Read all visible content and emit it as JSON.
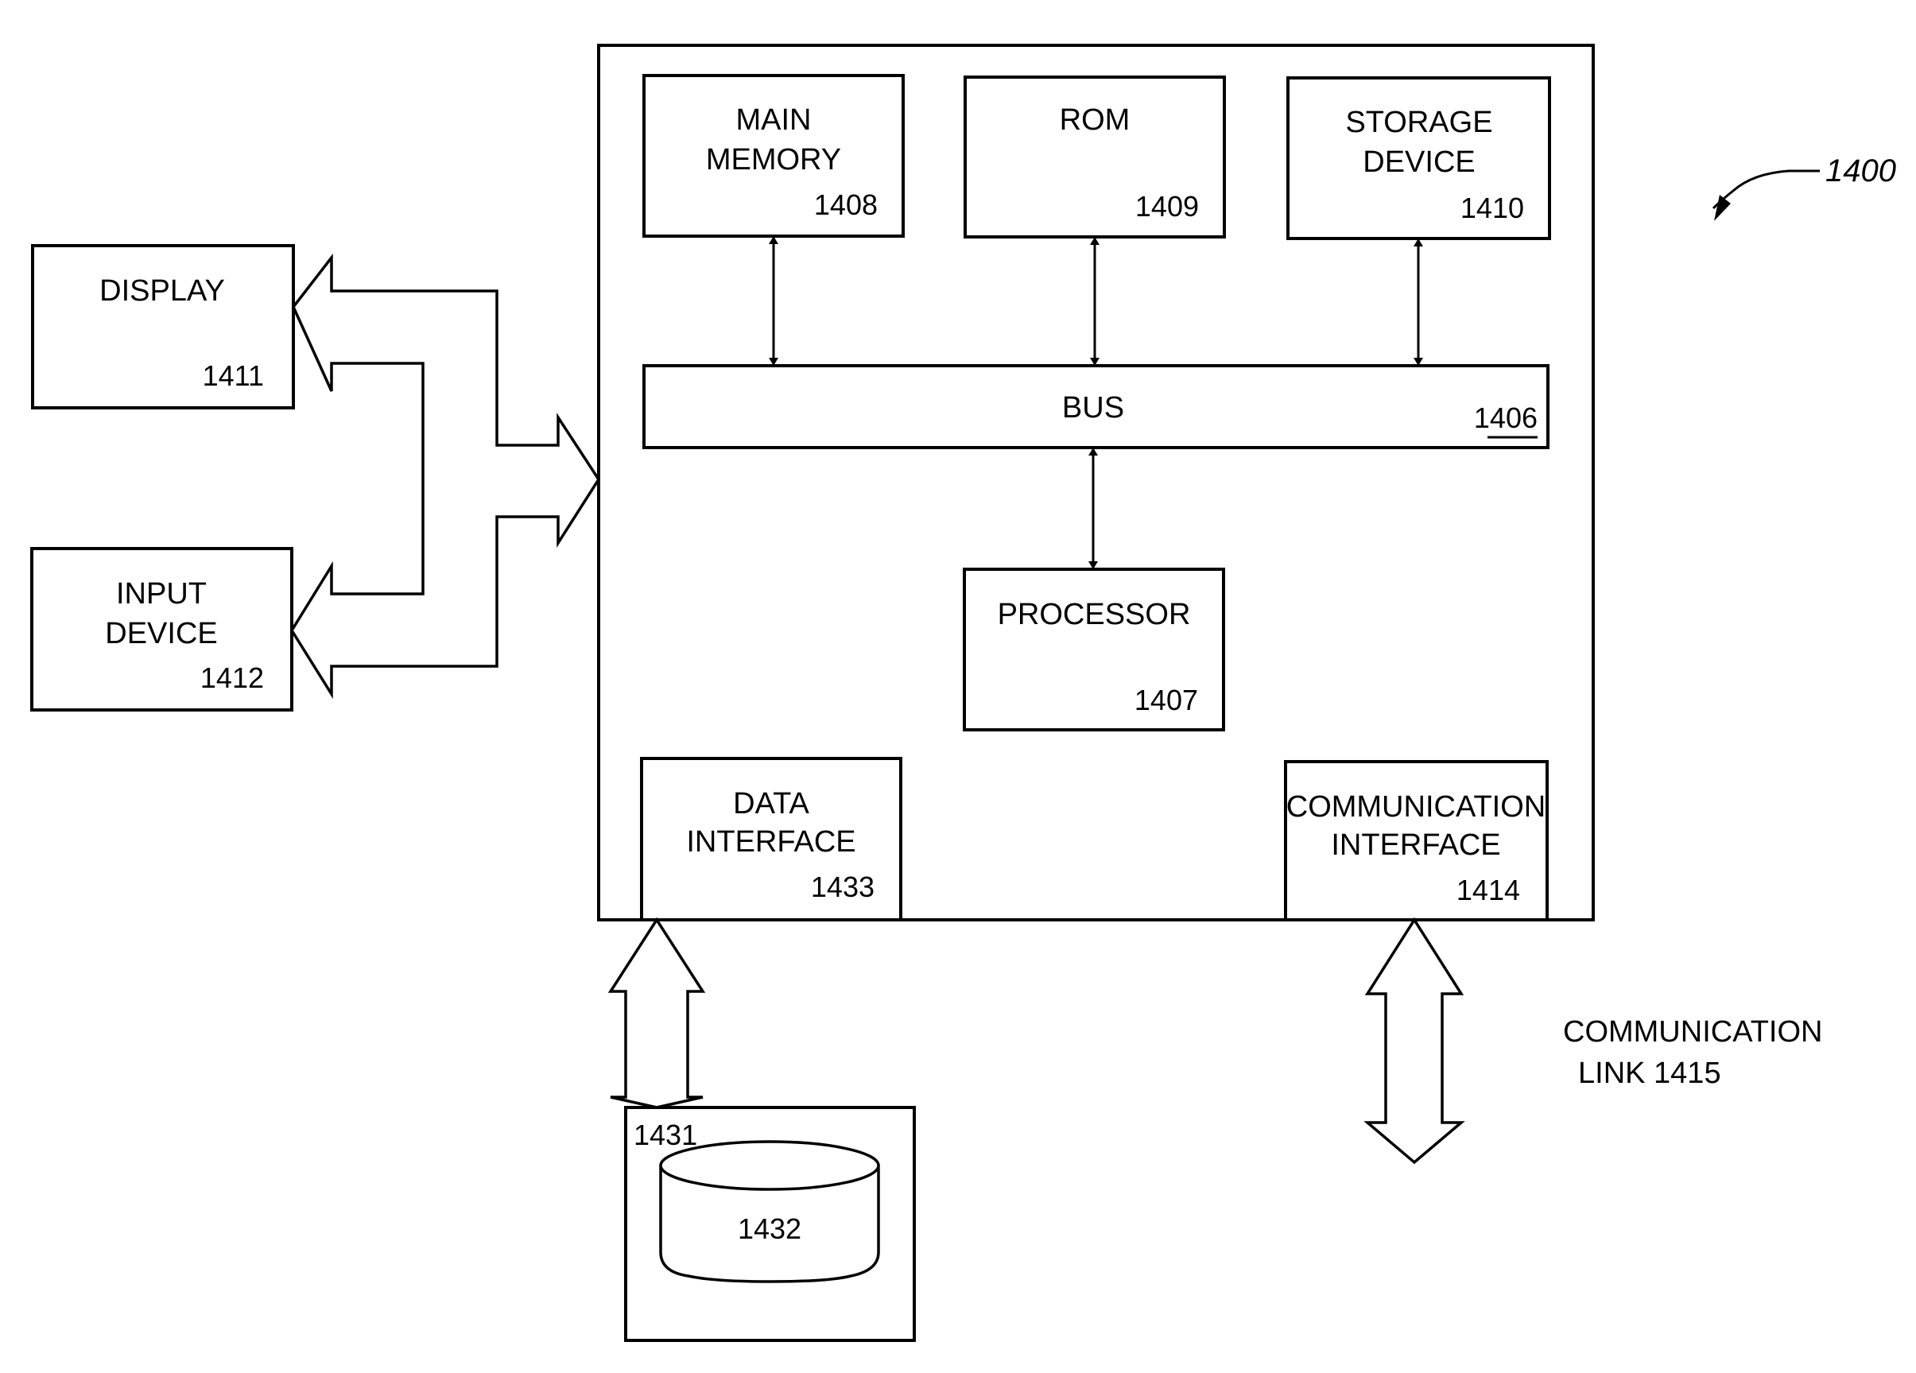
{
  "figure": {
    "reference": "1400"
  },
  "system": {
    "main_memory": {
      "line1": "MAIN",
      "line2": "MEMORY",
      "ref": "1408"
    },
    "rom": {
      "line1": "ROM",
      "ref": "1409"
    },
    "storage": {
      "line1": "STORAGE",
      "line2": "DEVICE",
      "ref": "1410"
    },
    "bus": {
      "label": "BUS",
      "ref": "1406"
    },
    "processor": {
      "label": "PROCESSOR",
      "ref": "1407"
    },
    "data_interface": {
      "line1": "DATA",
      "line2": "INTERFACE",
      "ref": "1433"
    },
    "comm_interface": {
      "line1": "COMMUNICATION",
      "line2": "INTERFACE",
      "ref": "1414"
    }
  },
  "peripherals": {
    "display": {
      "label": "DISPLAY",
      "ref": "1411"
    },
    "input_device": {
      "line1": "INPUT",
      "line2": "DEVICE",
      "ref": "1412"
    }
  },
  "external": {
    "database_box": {
      "ref": "1431"
    },
    "database": {
      "ref": "1432"
    },
    "comm_link": {
      "line1": "COMMUNICATION",
      "line2": "LINK  1415"
    }
  }
}
